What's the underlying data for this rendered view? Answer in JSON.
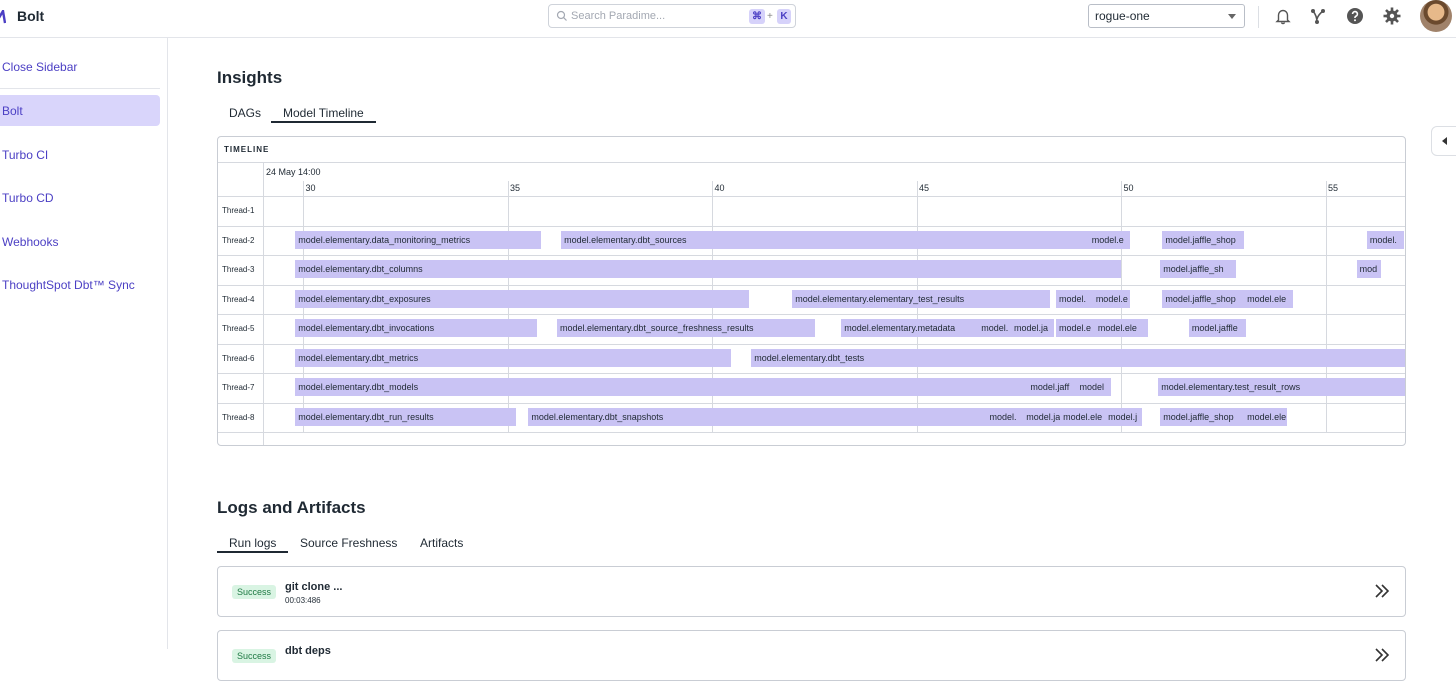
{
  "header": {
    "app_title": "Bolt",
    "search": {
      "placeholder": "Search Paradime...",
      "shortcut_key1": "⌘",
      "shortcut_plus": "+",
      "shortcut_key2": "K"
    },
    "workspace": "rogue-one"
  },
  "sidebar": {
    "items": [
      {
        "label": "Close Sidebar"
      },
      {
        "label": "Bolt"
      },
      {
        "label": "Turbo CI"
      },
      {
        "label": "Turbo CD"
      },
      {
        "label": "Webhooks"
      },
      {
        "label": "ThoughtSpot Dbt™ Sync"
      }
    ]
  },
  "insights": {
    "title": "Insights",
    "tabs": [
      {
        "label": "DAGs"
      },
      {
        "label": "Model Timeline"
      }
    ],
    "active_tab": "Model Timeline",
    "timeline": {
      "title": "TIMELINE",
      "date_label": "24 May 14:00",
      "ticks": [
        "30",
        "35",
        "40",
        "45",
        "50",
        "55"
      ],
      "threads": [
        "Thread-1",
        "Thread-2",
        "Thread-3",
        "Thread-4",
        "Thread-5",
        "Thread-6",
        "Thread-7",
        "Thread-8"
      ],
      "bar_color": "#c9c3f4",
      "bars": [
        {
          "thread": 1,
          "start": 29.8,
          "end": 35.8,
          "label": "model.elementary.data_monitoring_metrics"
        },
        {
          "thread": 1,
          "start": 36.3,
          "end": 50.2,
          "label": "model.elementary.dbt_sources"
        },
        {
          "thread": 1,
          "start": 49.2,
          "end": 50.2,
          "label": "model.e"
        },
        {
          "thread": 1,
          "start": 51.0,
          "end": 53.0,
          "label": "model.jaffle_shop"
        },
        {
          "thread": 1,
          "start": 56.0,
          "end": 56.9,
          "label": "model."
        },
        {
          "thread": 2,
          "start": 29.8,
          "end": 50.0,
          "label": "model.elementary.dbt_columns"
        },
        {
          "thread": 2,
          "start": 50.95,
          "end": 52.8,
          "label": "model.jaffle_sh"
        },
        {
          "thread": 2,
          "start": 55.75,
          "end": 56.35,
          "label": "mod"
        },
        {
          "thread": 3,
          "start": 29.8,
          "end": 40.9,
          "label": "model.elementary.dbt_exposures"
        },
        {
          "thread": 3,
          "start": 41.95,
          "end": 48.25,
          "label": "model.elementary.elementary_test_results"
        },
        {
          "thread": 3,
          "start": 48.4,
          "end": 49.3,
          "label": "model."
        },
        {
          "thread": 3,
          "start": 49.3,
          "end": 50.2,
          "label": "model.e"
        },
        {
          "thread": 3,
          "start": 51.0,
          "end": 53.0,
          "label": "model.jaffle_shop"
        },
        {
          "thread": 3,
          "start": 53.0,
          "end": 54.2,
          "label": "model.ele"
        },
        {
          "thread": 4,
          "start": 29.8,
          "end": 35.7,
          "label": "model.elementary.dbt_invocations"
        },
        {
          "thread": 4,
          "start": 36.2,
          "end": 42.5,
          "label": "model.elementary.dbt_source_freshness_results"
        },
        {
          "thread": 4,
          "start": 43.15,
          "end": 46.5,
          "label": "model.elementary.metadata"
        },
        {
          "thread": 4,
          "start": 46.5,
          "end": 47.3,
          "label": "model."
        },
        {
          "thread": 4,
          "start": 47.3,
          "end": 48.35,
          "label": "model.ja"
        },
        {
          "thread": 4,
          "start": 48.4,
          "end": 49.35,
          "label": "model.e"
        },
        {
          "thread": 4,
          "start": 49.35,
          "end": 50.65,
          "label": "model.ele"
        },
        {
          "thread": 4,
          "start": 51.65,
          "end": 53.05,
          "label": "model.jaffle"
        },
        {
          "thread": 5,
          "start": 29.8,
          "end": 40.45,
          "label": "model.elementary.dbt_metrics"
        },
        {
          "thread": 5,
          "start": 40.95,
          "end": 56.95,
          "label": "model.elementary.dbt_tests"
        },
        {
          "thread": 6,
          "start": 29.8,
          "end": 47.7,
          "label": "model.elementary.dbt_models"
        },
        {
          "thread": 6,
          "start": 47.7,
          "end": 48.9,
          "label": "model.jaff"
        },
        {
          "thread": 6,
          "start": 48.9,
          "end": 49.75,
          "label": "model"
        },
        {
          "thread": 6,
          "start": 50.9,
          "end": 57.3,
          "label": "model.elementary.test_result_rows"
        },
        {
          "thread": 7,
          "start": 29.8,
          "end": 35.2,
          "label": "model.elementary.dbt_run_results"
        },
        {
          "thread": 7,
          "start": 35.5,
          "end": 46.7,
          "label": "model.elementary.dbt_snapshots"
        },
        {
          "thread": 7,
          "start": 46.7,
          "end": 47.6,
          "label": "model."
        },
        {
          "thread": 7,
          "start": 47.6,
          "end": 48.5,
          "label": "model.jaffle"
        },
        {
          "thread": 7,
          "start": 48.5,
          "end": 49.6,
          "label": "model.ele"
        },
        {
          "thread": 7,
          "start": 49.6,
          "end": 50.5,
          "label": "model.j"
        },
        {
          "thread": 7,
          "start": 50.95,
          "end": 53.0,
          "label": "model.jaffle_shop"
        },
        {
          "thread": 7,
          "start": 53.0,
          "end": 54.05,
          "label": "model.ele"
        }
      ]
    }
  },
  "logs": {
    "title": "Logs and Artifacts",
    "tabs": [
      {
        "label": "Run logs"
      },
      {
        "label": "Source Freshness"
      },
      {
        "label": "Artifacts"
      }
    ],
    "active_tab": "Run logs",
    "entries": [
      {
        "status": "Success",
        "command": "git clone ...",
        "duration": "00:03:486"
      },
      {
        "status": "Success",
        "command": "dbt deps",
        "duration": ""
      }
    ]
  }
}
